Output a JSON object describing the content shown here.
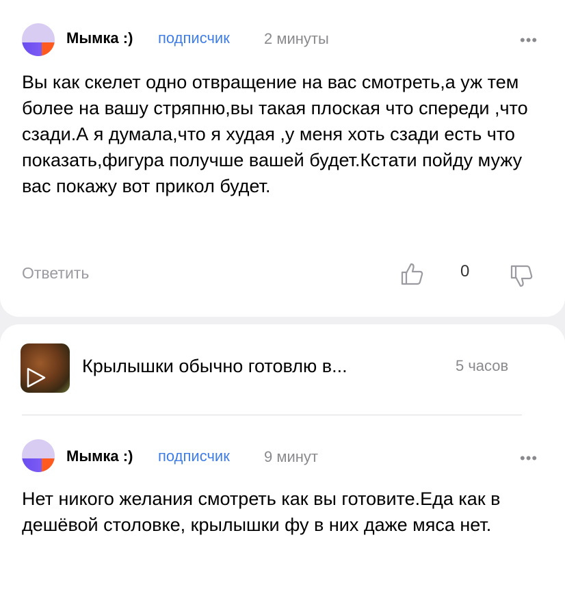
{
  "comments": [
    {
      "author": "Мымка :)",
      "badge": "подписчик",
      "time": "2 минуты",
      "more": "•••",
      "text": "Вы как скелет одно отвращение на вас смотреть,а уж тем более на вашу стряпню,вы такая плоская что спереди ,что сзади.А я думала,что я худая ,у меня хоть сзади есть что показать,фигура получше вашей будет.Кстати пойду мужу вас покажу вот прикол будет.",
      "reply_label": "Ответить",
      "likes": "0"
    },
    {
      "author": "Мымка :)",
      "badge": "подписчик",
      "time": "9 минут",
      "more": "•••",
      "text": "Нет никого желания смотреть как вы готовите.Еда как в дешёвой столовке, крылышки фу в них даже мяса нет."
    }
  ],
  "post": {
    "title": "Крылышки обычно готовлю в...",
    "time": "5 часов"
  },
  "icons": {
    "like": "thumbs-up-icon",
    "dislike": "thumbs-down-icon",
    "play": "play-icon"
  },
  "colors": {
    "accent": "#3f7de6",
    "muted": "#8a8a8e"
  }
}
